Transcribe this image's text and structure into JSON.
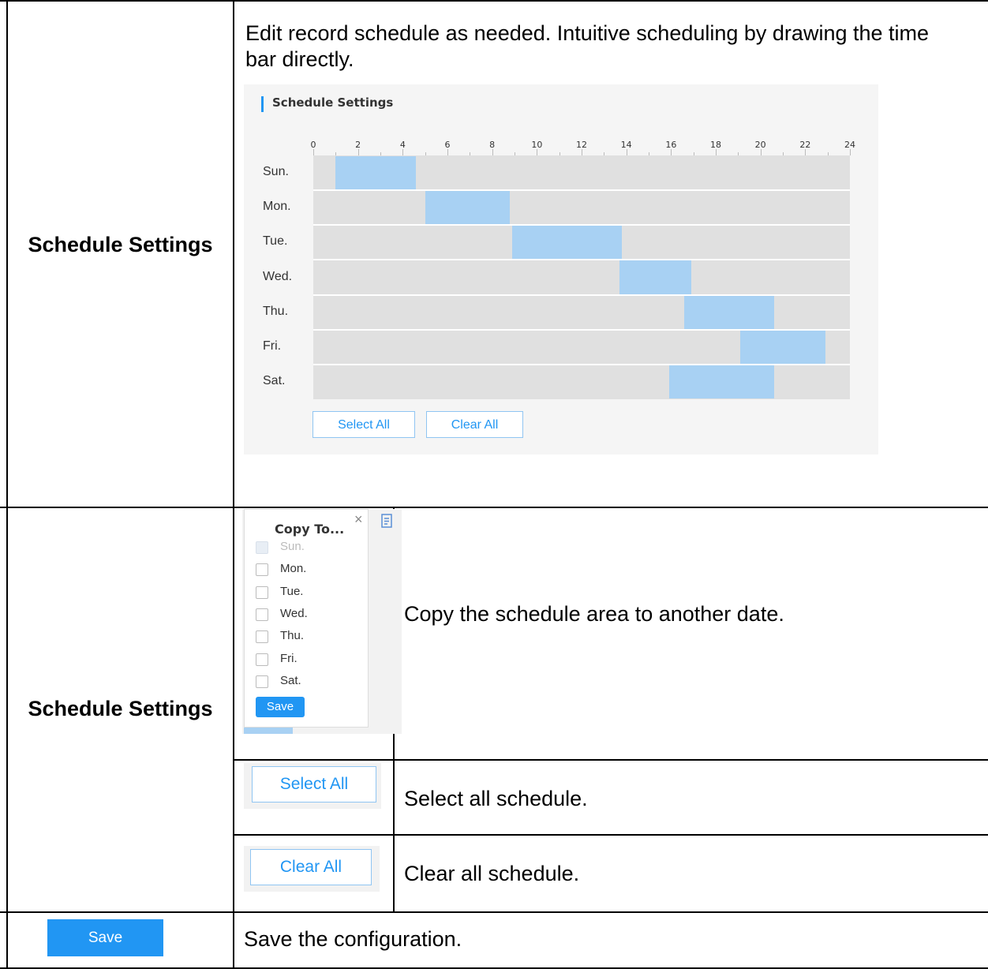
{
  "rows": {
    "r1": {
      "label": "Schedule Settings",
      "desc": "Edit record schedule as needed. Intuitive scheduling by drawing the time bar directly."
    },
    "r2": {
      "label": "Schedule Settings",
      "copy_desc": "Copy the schedule area to another date.",
      "select_desc": "Select all schedule.",
      "clear_desc": "Clear all schedule."
    },
    "r3": {
      "desc": "Save the configuration."
    }
  },
  "schedule": {
    "title": "Schedule Settings",
    "hours": [
      "0",
      "2",
      "4",
      "6",
      "8",
      "10",
      "12",
      "14",
      "16",
      "18",
      "20",
      "22",
      "24"
    ],
    "days": [
      "Sun.",
      "Mon.",
      "Tue.",
      "Wed.",
      "Thu.",
      "Fri.",
      "Sat."
    ],
    "blocks": [
      {
        "day": "Sun.",
        "start": 1,
        "end": 4.6
      },
      {
        "day": "Mon.",
        "start": 5,
        "end": 8.8
      },
      {
        "day": "Tue.",
        "start": 8.9,
        "end": 13.8
      },
      {
        "day": "Wed.",
        "start": 13.7,
        "end": 16.9
      },
      {
        "day": "Thu.",
        "start": 16.6,
        "end": 20.6
      },
      {
        "day": "Fri.",
        "start": 19.1,
        "end": 22.9
      },
      {
        "day": "Sat.",
        "start": 15.9,
        "end": 20.6
      }
    ],
    "select_all": "Select All",
    "clear_all": "Clear All",
    "block_color": "#a8d1f3",
    "accent": "#2196f3"
  },
  "copy_popup": {
    "title": "Copy To...",
    "items": [
      {
        "label": "Sun.",
        "disabled": true
      },
      {
        "label": "Mon.",
        "disabled": false
      },
      {
        "label": "Tue.",
        "disabled": false
      },
      {
        "label": "Wed.",
        "disabled": false
      },
      {
        "label": "Thu.",
        "disabled": false
      },
      {
        "label": "Fri.",
        "disabled": false
      },
      {
        "label": "Sat.",
        "disabled": false
      }
    ],
    "save": "Save"
  },
  "buttons": {
    "select_all": "Select All",
    "clear_all": "Clear All",
    "save": "Save"
  }
}
